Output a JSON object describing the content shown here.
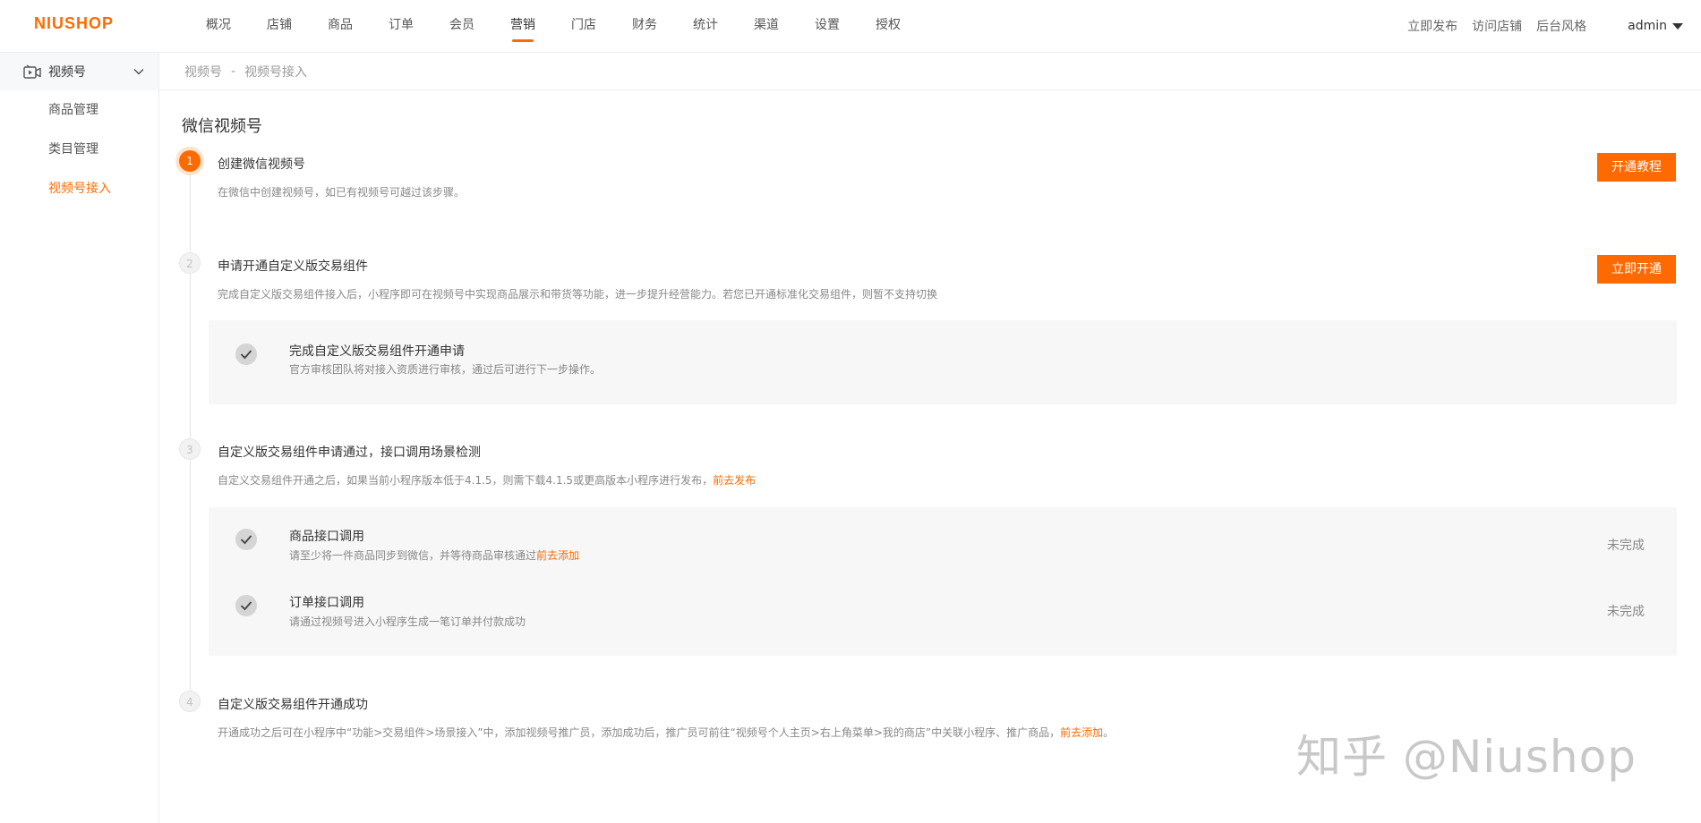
{
  "header": {
    "logo": "NIUSHOP",
    "nav": [
      {
        "label": "概况",
        "active": false
      },
      {
        "label": "店铺",
        "active": false
      },
      {
        "label": "商品",
        "active": false
      },
      {
        "label": "订单",
        "active": false
      },
      {
        "label": "会员",
        "active": false
      },
      {
        "label": "营销",
        "active": true
      },
      {
        "label": "门店",
        "active": false
      },
      {
        "label": "财务",
        "active": false
      },
      {
        "label": "统计",
        "active": false
      },
      {
        "label": "渠道",
        "active": false
      },
      {
        "label": "设置",
        "active": false
      },
      {
        "label": "授权",
        "active": false
      }
    ],
    "links": [
      "立即发布",
      "访问店铺",
      "后台风格"
    ],
    "user": "admin"
  },
  "sidebar": {
    "group_label": "视频号",
    "group_icon": "video-icon",
    "items": [
      {
        "label": "商品管理",
        "active": false
      },
      {
        "label": "类目管理",
        "active": false
      },
      {
        "label": "视频号接入",
        "active": true
      }
    ]
  },
  "breadcrumb": {
    "items": [
      "视频号",
      "视频号接入"
    ],
    "separator": "-"
  },
  "page": {
    "title": "微信视频号",
    "steps": [
      {
        "num": "1",
        "title": "创建微信视频号",
        "desc": "在微信中创建视频号，如已有视频号可越过该步骤。",
        "button": "开通教程"
      },
      {
        "num": "2",
        "title": "申请开通自定义版交易组件",
        "desc": "完成自定义版交易组件接入后，小程序即可在视频号中实现商品展示和带货等功能，进一步提升经营能力。若您已开通标准化交易组件，则暂不支持切换",
        "button": "立即开通",
        "tasks": [
          {
            "title": "完成自定义版交易组件开通申请",
            "desc": "官方审核团队将对接入资质进行审核，通过后可进行下一步操作。"
          }
        ]
      },
      {
        "num": "3",
        "title": "自定义版交易组件申请通过，接口调用场景检测",
        "desc": "自定义交易组件开通之后，如果当前小程序版本低于4.1.5，则需下载4.1.5或更高版本小程序进行发布，",
        "desc_link": "前去发布",
        "tasks": [
          {
            "title": "商品接口调用",
            "desc": "请至少将一件商品同步到微信，并等待商品审核通过",
            "desc_link": "前去添加",
            "status": "未完成"
          },
          {
            "title": "订单接口调用",
            "desc": "请通过视频号进入小程序生成一笔订单并付款成功",
            "status": "未完成"
          }
        ]
      },
      {
        "num": "4",
        "title": "自定义版交易组件开通成功",
        "desc": "开通成功之后可在小程序中“功能>交易组件>场景接入”中，添加视频号推广员，添加成功后，推广员可前往“视频号个人主页>右上角菜单>我的商店”中关联小程序、推广商品，",
        "desc_link": "前去添加",
        "desc_end": "。"
      }
    ]
  },
  "watermark": "知乎 @Niushop",
  "colors": {
    "accent": "#ff6a00",
    "muted": "#888888",
    "panel_bg": "#f7f7f7"
  }
}
